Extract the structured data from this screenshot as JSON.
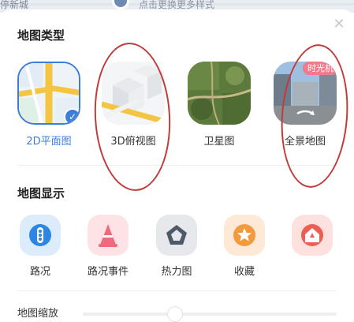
{
  "background": {
    "left_text": "停新城",
    "hint_text": "点击更换更多样式"
  },
  "sheet": {
    "close_icon": "close-icon",
    "map_type_title": "地图类型",
    "map_types": [
      {
        "label": "2D平面图",
        "selected": true
      },
      {
        "label": "3D俯视图",
        "selected": false
      },
      {
        "label": "卫星图",
        "selected": false
      },
      {
        "label": "全景地图",
        "selected": false,
        "badge": "时光机"
      }
    ],
    "display_title": "地图显示",
    "layers": [
      {
        "label": "路况",
        "icon": "traffic-light-icon"
      },
      {
        "label": "路况事件",
        "icon": "traffic-cone-icon"
      },
      {
        "label": "热力图",
        "icon": "pentagon-icon"
      },
      {
        "label": "收藏",
        "icon": "star-icon"
      },
      {
        "label": "",
        "icon": "home-icon"
      }
    ],
    "zoom_title": "地图缩放"
  },
  "colors": {
    "accent": "#3b7dd8",
    "annotation": "#c33a3a"
  }
}
